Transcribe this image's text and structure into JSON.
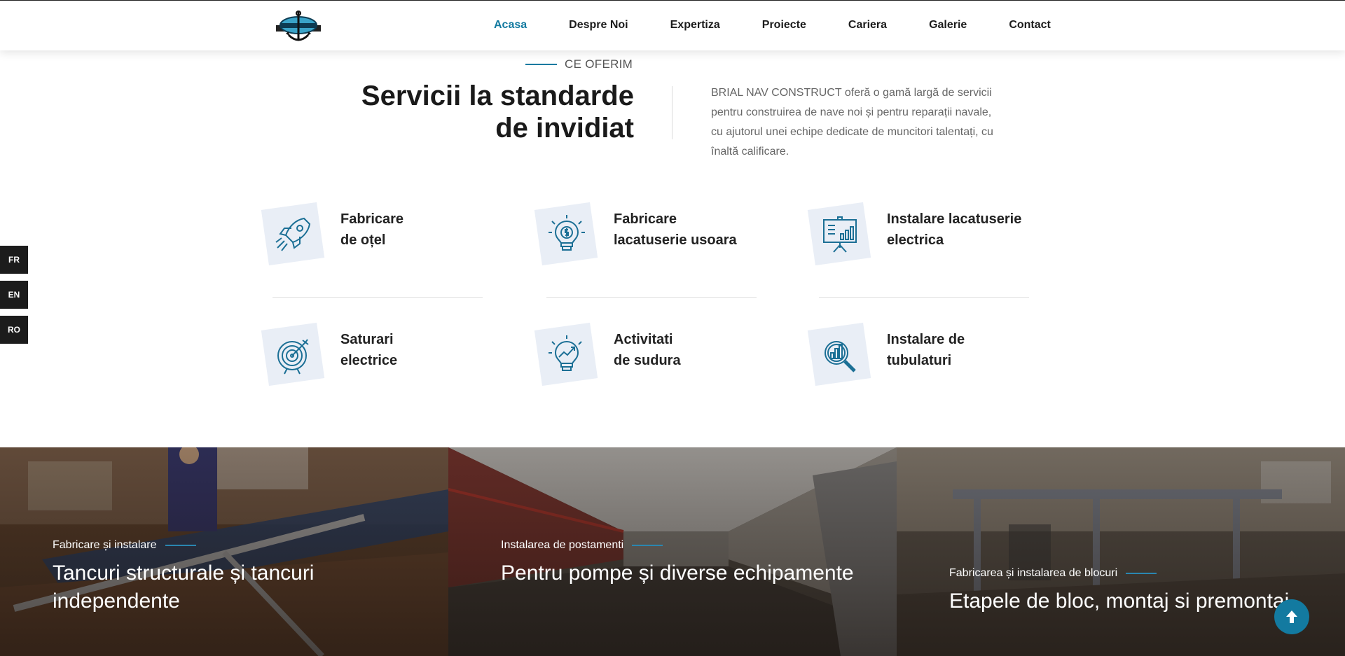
{
  "header": {
    "logo_icon": "anchor-logo-icon",
    "nav": [
      {
        "label": "Acasa",
        "active": true
      },
      {
        "label": "Despre Noi",
        "active": false
      },
      {
        "label": "Expertiza",
        "active": false
      },
      {
        "label": "Proiecte",
        "active": false
      },
      {
        "label": "Cariera",
        "active": false
      },
      {
        "label": "Galerie",
        "active": false
      },
      {
        "label": "Contact",
        "active": false
      }
    ]
  },
  "intro": {
    "eyebrow": "CE OFERIM",
    "heading_line1": "Servicii la standarde",
    "heading_line2": "de invidiat",
    "text": "BRIAL NAV CONSTRUCT oferă o gamă largă de servicii pentru construirea de nave noi și pentru reparații navale, cu ajutorul unei echipe dedicate de muncitori talentați, cu înaltă calificare."
  },
  "services": [
    {
      "line1": "Fabricare",
      "line2": "de oțel",
      "icon": "rocket-icon"
    },
    {
      "line1": "Fabricare",
      "line2": "lacatuserie usoara",
      "icon": "lightbulb-dollar-icon"
    },
    {
      "line1": "Instalare lacatuserie",
      "line2": "electrica",
      "icon": "presentation-board-icon"
    },
    {
      "line1": "Saturari",
      "line2": "electrice",
      "icon": "target-icon"
    },
    {
      "line1": "Activitati",
      "line2": "de sudura",
      "icon": "lightbulb-growth-icon"
    },
    {
      "line1": "Instalare de",
      "line2": "tubulaturi",
      "icon": "magnifier-chart-icon"
    }
  ],
  "languages": [
    "FR",
    "EN",
    "RO"
  ],
  "cards": [
    {
      "meta": "Fabricare și instalare",
      "title": "Tancuri structurale și tancuri independente"
    },
    {
      "meta": "Instalarea de postamenti",
      "title": "Pentru pompe și diverse echipamente"
    },
    {
      "meta": "Fabricarea și instalarea de blocuri",
      "title": "Etapele de bloc, montaj si premontaj"
    }
  ],
  "colors": {
    "accent": "#137aa0",
    "icon_bg": "#e9eef6",
    "dark_tab": "#1c1c1c"
  }
}
